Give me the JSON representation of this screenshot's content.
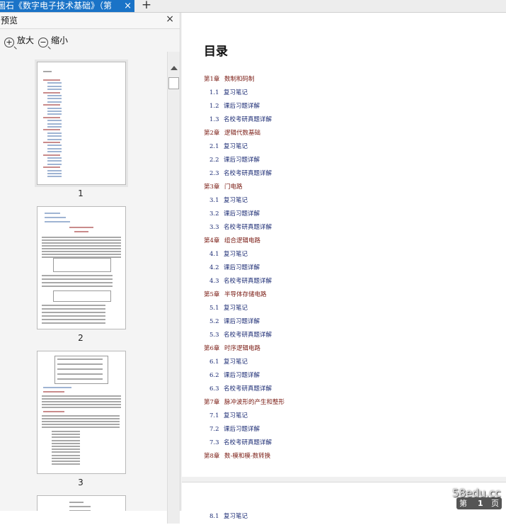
{
  "tab": {
    "title": "圖石《数字电子技术基础》（第",
    "close": "×",
    "new_tab": "+"
  },
  "preview": {
    "title": "预览",
    "close": "×",
    "zoom_in": "放大",
    "zoom_out": "缩小",
    "zoom_in_glyph": "+",
    "zoom_out_glyph": "−",
    "pages": [
      {
        "number": "1",
        "selected": true
      },
      {
        "number": "2",
        "selected": false
      },
      {
        "number": "3",
        "selected": false
      }
    ]
  },
  "document": {
    "title": "目录",
    "toc": [
      {
        "num": "第1章",
        "title": "数制和码制",
        "sections": [
          {
            "num": "1.1",
            "title": "复习笔记"
          },
          {
            "num": "1.2",
            "title": "课后习题详解"
          },
          {
            "num": "1.3",
            "title": "名校考研真题详解"
          }
        ]
      },
      {
        "num": "第2章",
        "title": "逻辑代数基础",
        "sections": [
          {
            "num": "2.1",
            "title": "复习笔记"
          },
          {
            "num": "2.2",
            "title": "课后习题详解"
          },
          {
            "num": "2.3",
            "title": "名校考研真题详解"
          }
        ]
      },
      {
        "num": "第3章",
        "title": "门电路",
        "sections": [
          {
            "num": "3.1",
            "title": "复习笔记"
          },
          {
            "num": "3.2",
            "title": "课后习题详解"
          },
          {
            "num": "3.3",
            "title": "名校考研真题详解"
          }
        ]
      },
      {
        "num": "第4章",
        "title": "组合逻辑电路",
        "sections": [
          {
            "num": "4.1",
            "title": "复习笔记"
          },
          {
            "num": "4.2",
            "title": "课后习题详解"
          },
          {
            "num": "4.3",
            "title": "名校考研真题详解"
          }
        ]
      },
      {
        "num": "第5章",
        "title": "半导体存储电路",
        "sections": [
          {
            "num": "5.1",
            "title": "复习笔记"
          },
          {
            "num": "5.2",
            "title": "课后习题详解"
          },
          {
            "num": "5.3",
            "title": "名校考研真题详解"
          }
        ]
      },
      {
        "num": "第6章",
        "title": "时序逻辑电路",
        "sections": [
          {
            "num": "6.1",
            "title": "复习笔记"
          },
          {
            "num": "6.2",
            "title": "课后习题详解"
          },
          {
            "num": "6.3",
            "title": "名校考研真题详解"
          }
        ]
      },
      {
        "num": "第7章",
        "title": "脉冲波形的产生和整形",
        "sections": [
          {
            "num": "7.1",
            "title": "复习笔记"
          },
          {
            "num": "7.2",
            "title": "课后习题详解"
          },
          {
            "num": "7.3",
            "title": "名校考研真题详解"
          }
        ]
      },
      {
        "num": "第8章",
        "title": "数-模和模-数转换",
        "sections": []
      }
    ],
    "next_page_section": {
      "num": "8.1",
      "title": "复习笔记"
    }
  },
  "page_indicator": {
    "prefix": "第",
    "current": "1",
    "suffix": "页"
  },
  "watermark": "58edu.cc",
  "colors": {
    "tab_active": "#1a73c7",
    "chapter": "#7a1b13",
    "section": "#1a2a73"
  }
}
